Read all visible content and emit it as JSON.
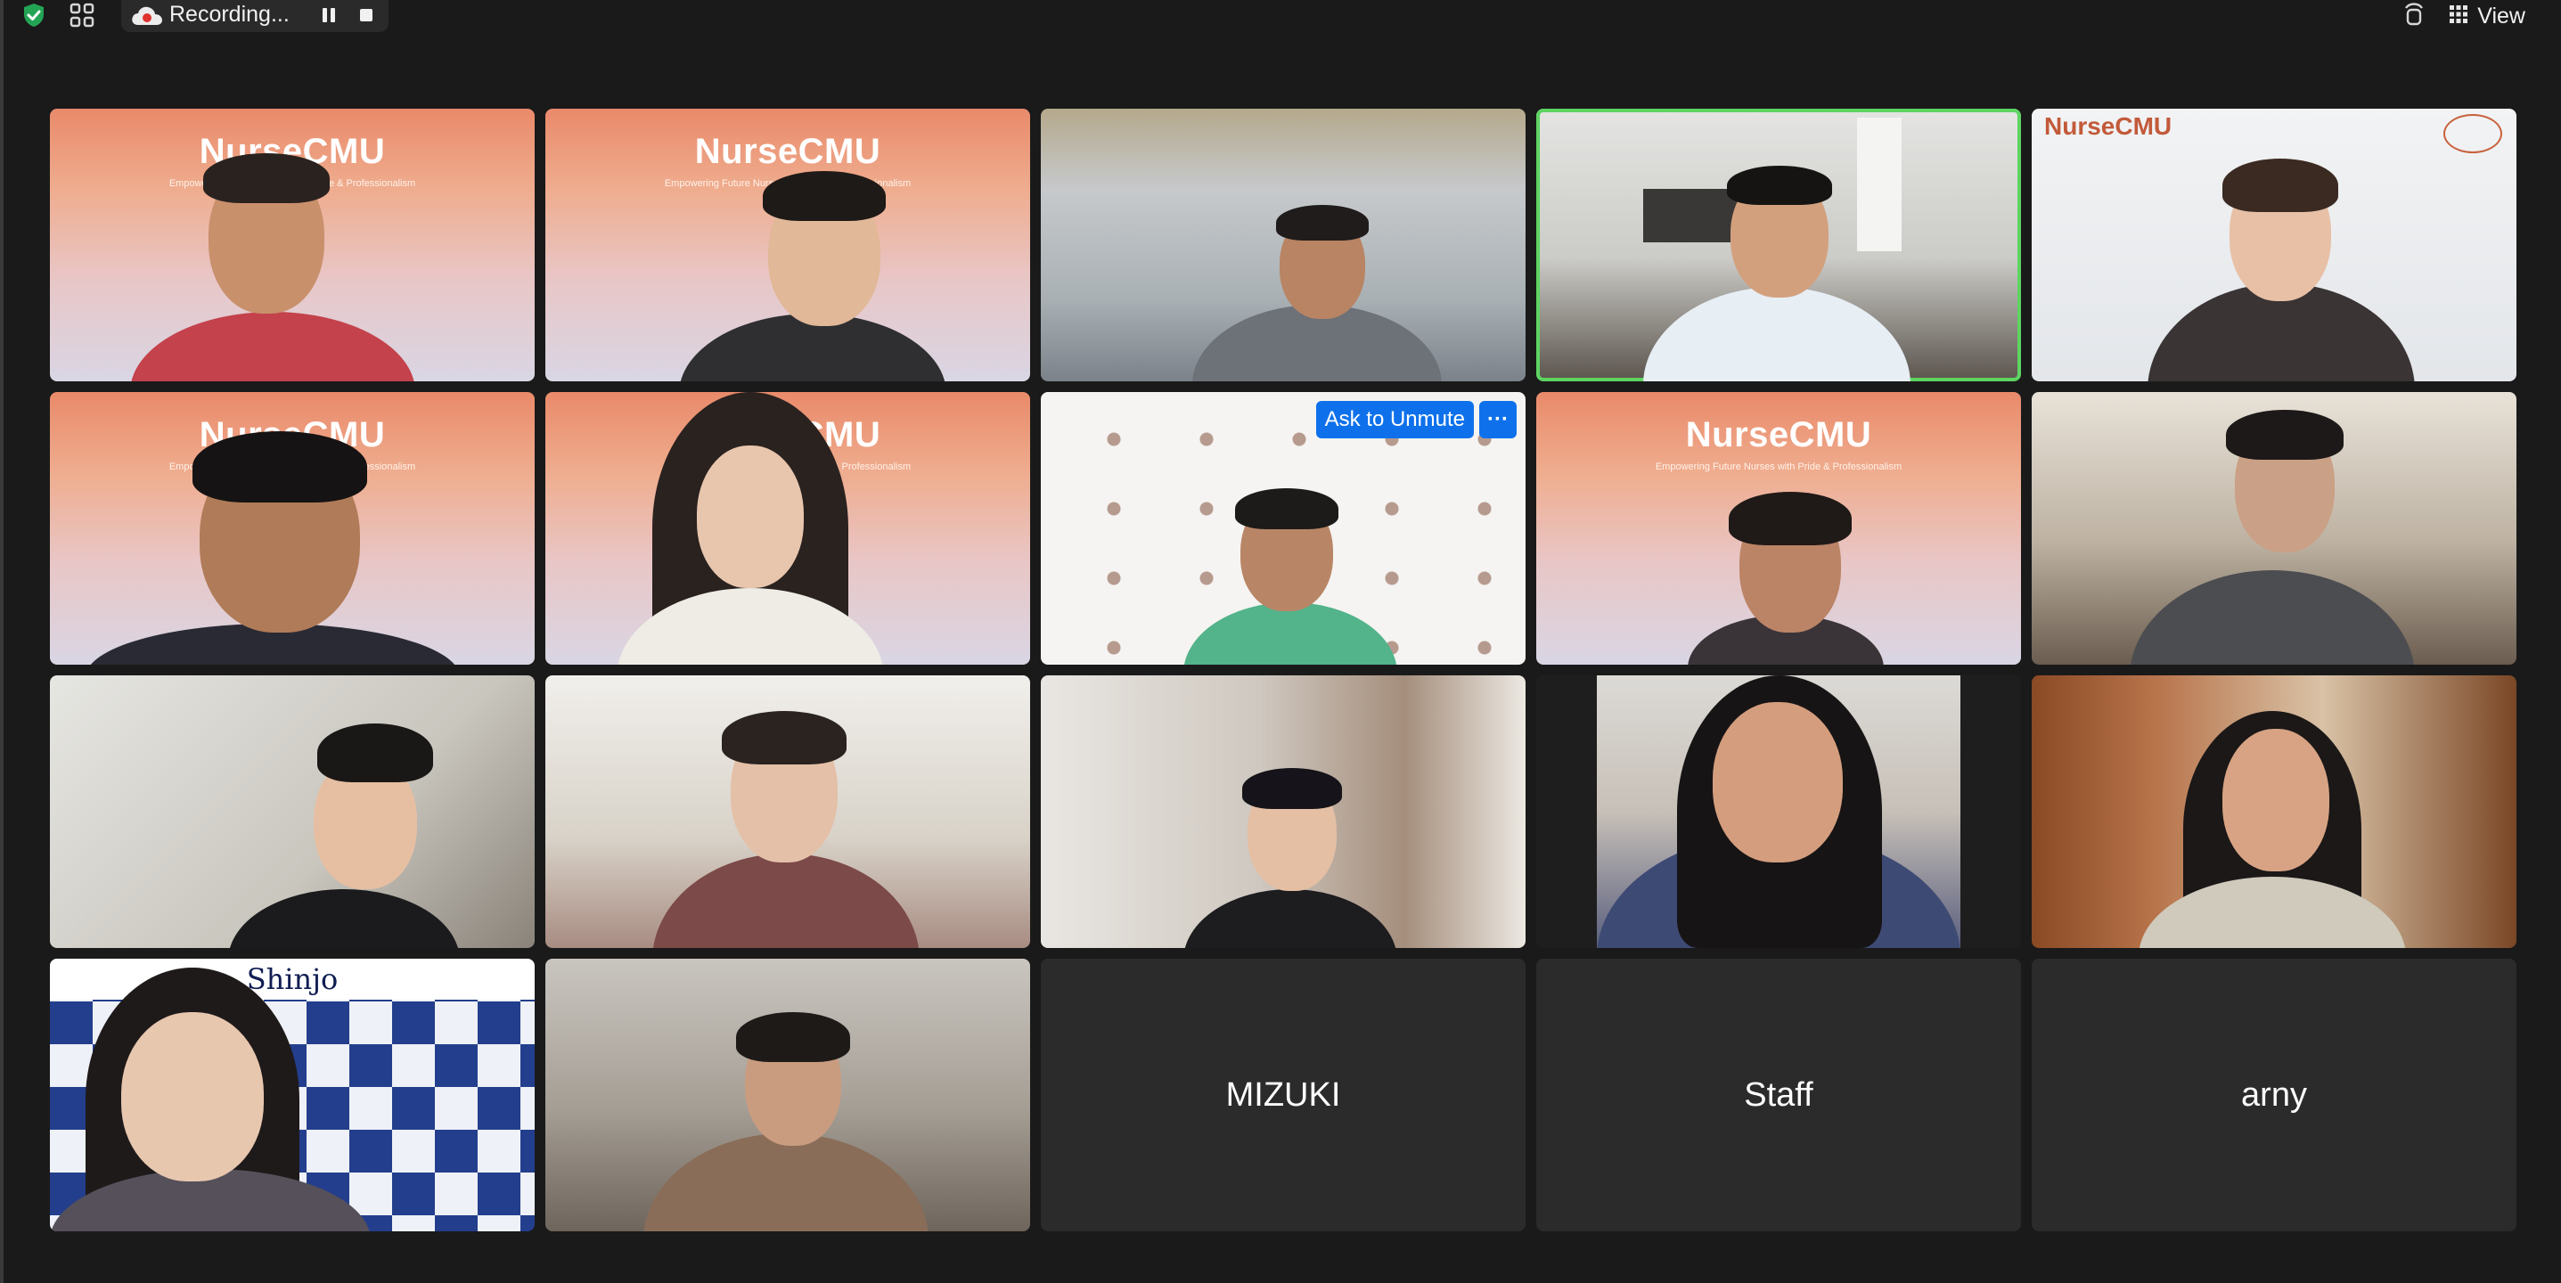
{
  "topbar": {
    "recording_label": "Recording...",
    "view_label": "View",
    "icons": [
      "shield-check-icon",
      "grid-icon",
      "cloud-record-icon",
      "pause-icon",
      "stop-icon",
      "immersive-icon",
      "view-grid-icon"
    ]
  },
  "gallery": {
    "banner_title": "NurseCMU",
    "banner_subtitle": "Empowering Future Nurses with Pride & Professionalism",
    "corner_logo": "NurseCMU",
    "shinjo_label": "Shinjo",
    "name_tiles": [
      "MIZUKI",
      "Staff",
      "arny"
    ],
    "ask_to_unmute": "Ask to Unmute",
    "more_label": "···"
  },
  "colors": {
    "active_speaker": "#5ed462",
    "unmute_blue": "#0e71eb",
    "background": "#1a1a1a",
    "tile_empty": "#2b2b2b"
  }
}
